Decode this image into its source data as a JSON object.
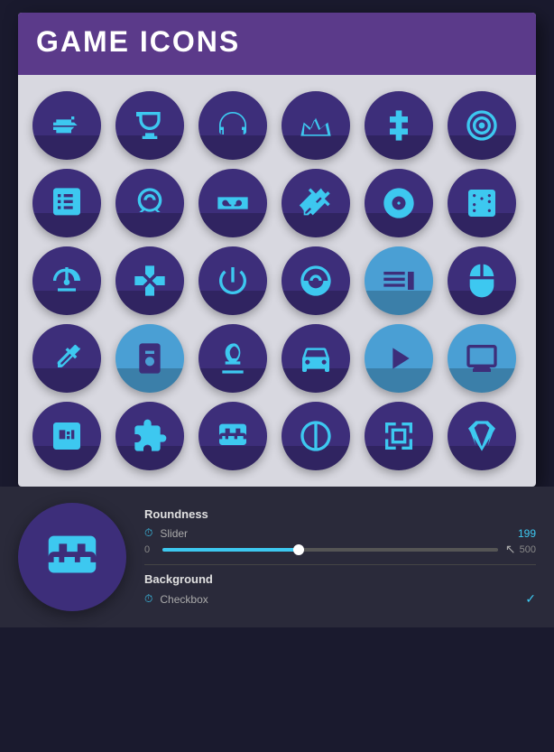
{
  "header": {
    "title": "GAME ICONS"
  },
  "icons": [
    {
      "name": "gun-icon",
      "symbol": "🔫",
      "type": "dark"
    },
    {
      "name": "trophy-icon",
      "symbol": "🏆",
      "type": "dark"
    },
    {
      "name": "headphones-icon",
      "symbol": "🎧",
      "type": "dark"
    },
    {
      "name": "crown-icon",
      "symbol": "👑",
      "type": "dark"
    },
    {
      "name": "dpad-icon",
      "symbol": "✛",
      "type": "dark"
    },
    {
      "name": "target-icon",
      "symbol": "⊕",
      "type": "dark"
    },
    {
      "name": "cards-icon",
      "symbol": "🂠",
      "type": "dark"
    },
    {
      "name": "horseshoe-icon",
      "symbol": "⌂",
      "type": "dark"
    },
    {
      "name": "vr-icon",
      "symbol": "⬡",
      "type": "dark"
    },
    {
      "name": "swords-icon",
      "symbol": "✕",
      "type": "dark"
    },
    {
      "name": "disc-icon",
      "symbol": "◎",
      "type": "dark"
    },
    {
      "name": "dice-icon",
      "symbol": "⚄",
      "type": "dark"
    },
    {
      "name": "joystick-icon",
      "symbol": "🕹",
      "type": "dark"
    },
    {
      "name": "gamepad-icon",
      "symbol": "🎮",
      "type": "dark"
    },
    {
      "name": "power-icon",
      "symbol": "⏻",
      "type": "dark"
    },
    {
      "name": "steering-icon",
      "symbol": "◉",
      "type": "dark"
    },
    {
      "name": "start-icon",
      "symbol": "▶",
      "type": "light"
    },
    {
      "name": "mouse-icon",
      "symbol": "🖱",
      "type": "dark"
    },
    {
      "name": "guitar-icon",
      "symbol": "🎸",
      "type": "dark"
    },
    {
      "name": "mp3-icon",
      "symbol": "📱",
      "type": "light"
    },
    {
      "name": "chess-icon",
      "symbol": "♞",
      "type": "dark"
    },
    {
      "name": "car-icon",
      "symbol": "🚗",
      "type": "dark"
    },
    {
      "name": "play-icon",
      "symbol": "▶",
      "type": "light"
    },
    {
      "name": "monitor-icon",
      "symbol": "🖥",
      "type": "light"
    },
    {
      "name": "slots-icon",
      "symbol": "🎰",
      "type": "dark"
    },
    {
      "name": "puzzle-icon",
      "symbol": "🧩",
      "type": "dark"
    },
    {
      "name": "gamepad2-icon",
      "symbol": "🎮",
      "type": "dark"
    },
    {
      "name": "ball-icon",
      "symbol": "⚽",
      "type": "dark"
    },
    {
      "name": "tictactoe-icon",
      "symbol": "✕○",
      "type": "dark"
    },
    {
      "name": "gem-icon",
      "symbol": "💎",
      "type": "dark"
    }
  ],
  "preview": {
    "icon_name": "gamepad-preview-icon"
  },
  "controls": {
    "roundness_label": "Roundness",
    "slider_label": "Slider",
    "slider_value": "199",
    "range_min": "0",
    "range_max": "500",
    "background_label": "Background",
    "checkbox_label": "Checkbox",
    "checkbox_checked": "✓"
  }
}
